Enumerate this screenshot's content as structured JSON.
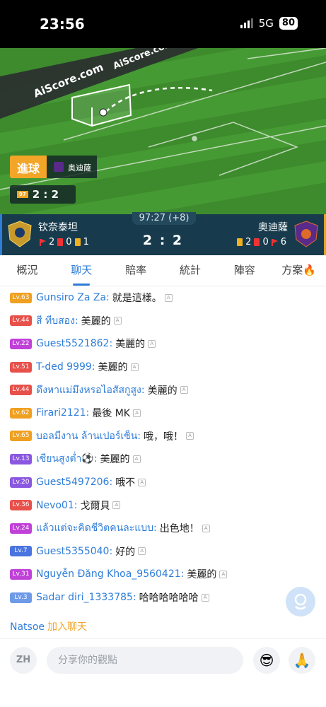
{
  "status": {
    "time": "23:56",
    "network": "5G",
    "battery": "80"
  },
  "pitch": {
    "watermark": "AiScore.com",
    "goal_label": "進球",
    "goal_team": "奥迪薩",
    "mini_score": "2 : 2"
  },
  "match": {
    "time": "97:27 (+8)",
    "home": {
      "name": "钦奈泰坦",
      "corners": "2",
      "red": "0",
      "yellow": "1"
    },
    "away": {
      "name": "奥迪薩",
      "yellow": "2",
      "red": "0",
      "corners": "6"
    },
    "score": "2 : 2"
  },
  "tabs": [
    {
      "label": "概況"
    },
    {
      "label": "聊天"
    },
    {
      "label": "賠率"
    },
    {
      "label": "統計"
    },
    {
      "label": "陣容"
    },
    {
      "label": "方案"
    }
  ],
  "chat": [
    {
      "lv": "Lv.63",
      "color": "#f0a020",
      "user": "Gunsiro Za Za:",
      "msg": "就是這樣。"
    },
    {
      "lv": "Lv.44",
      "color": "#e8504a",
      "user": "สี ทีบสอง:",
      "msg": "美麗的"
    },
    {
      "lv": "Lv.22",
      "color": "#c041d8",
      "user": "Guest5521862:",
      "msg": "美麗的"
    },
    {
      "lv": "Lv.51",
      "color": "#e8504a",
      "user": "T-ded 9999:",
      "msg": "美麗的"
    },
    {
      "lv": "Lv.44",
      "color": "#e8504a",
      "user": "ดึงหาแม่มึงหรอไอสัสกูสูง:",
      "msg": "美麗的"
    },
    {
      "lv": "Lv.62",
      "color": "#f0a020",
      "user": "Firari2121:",
      "msg": "最後 MK"
    },
    {
      "lv": "Lv.65",
      "color": "#f0a020",
      "user": "บอลมีงาน ล้านเปอร์เซ็น:",
      "msg": "哦，哦！"
    },
    {
      "lv": "Lv.13",
      "color": "#8a57e0",
      "user": "เซียนสูงต่ำ⚽:",
      "msg": "美麗的"
    },
    {
      "lv": "Lv.20",
      "color": "#8a57e0",
      "user": "Guest5497206:",
      "msg": "哦不"
    },
    {
      "lv": "Lv.36",
      "color": "#e8504a",
      "user": "Nevo01:",
      "msg": "戈爾貝"
    },
    {
      "lv": "Lv.24",
      "color": "#c041d8",
      "user": "แล้วแต่จะคิดชีวิตคนละแบบ:",
      "msg": "出色地！"
    },
    {
      "lv": "Lv.7",
      "color": "#4a74e0",
      "user": "Guest5355040:",
      "msg": "好的"
    },
    {
      "lv": "Lv.31",
      "color": "#c041d8",
      "user": "Nguyễn Đăng Khoa_9560421:",
      "msg": "美麗的"
    },
    {
      "lv": "Lv.3",
      "color": "#6e9ae8",
      "user": "Sadar diri_1333785:",
      "msg": "哈哈哈哈哈哈"
    }
  ],
  "join": {
    "name": "Natsoe",
    "text": "加入聊天"
  },
  "composer": {
    "lang": "ZH",
    "placeholder": "分享你的觀點"
  }
}
